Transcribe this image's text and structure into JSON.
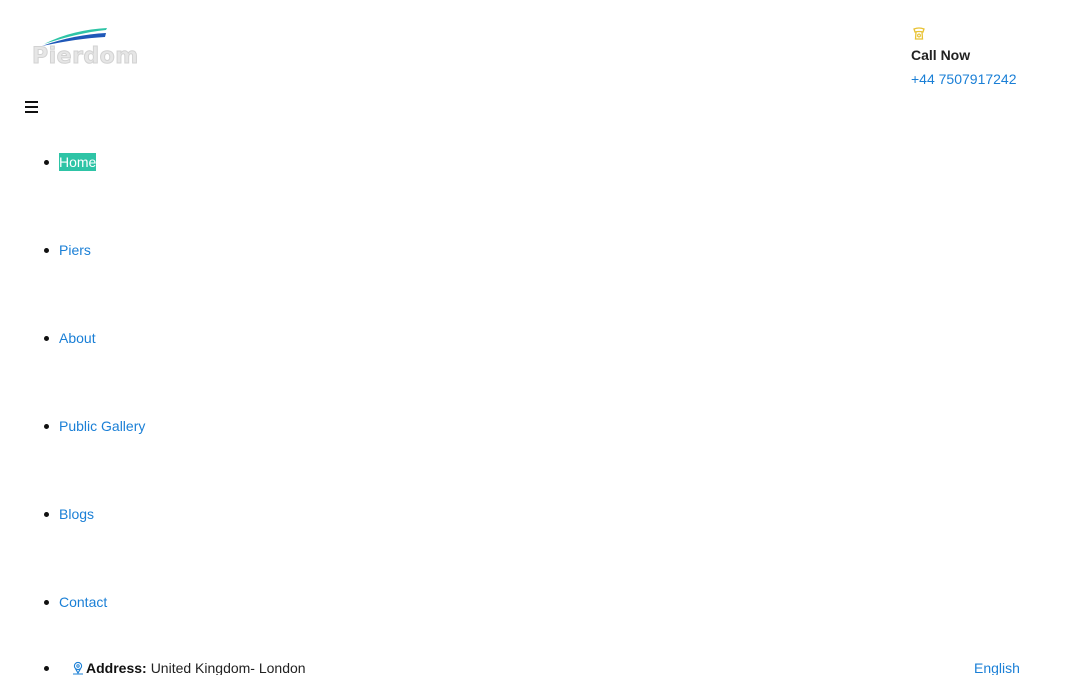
{
  "header": {
    "logo_text": "Pierdom",
    "phone_icon": "phone-icon",
    "call_label": "Call Now",
    "call_number": "+44 7507917242"
  },
  "menu_toggle_icon": "hamburger-icon",
  "nav": {
    "items": [
      {
        "label": "Home",
        "active": true
      },
      {
        "label": "Piers",
        "active": false
      },
      {
        "label": "About",
        "active": false
      },
      {
        "label": "Public Gallery",
        "active": false
      },
      {
        "label": "Blogs",
        "active": false
      },
      {
        "label": "Contact",
        "active": false
      }
    ]
  },
  "contact_bar": {
    "address_icon": "location-pin-icon",
    "address_label": "Address:",
    "address_value": "United Kingdom- London",
    "language": "English"
  },
  "colors": {
    "link": "#1a7fd6",
    "active_bg": "#2ec4a6",
    "phone_icon": "#e8c233"
  }
}
